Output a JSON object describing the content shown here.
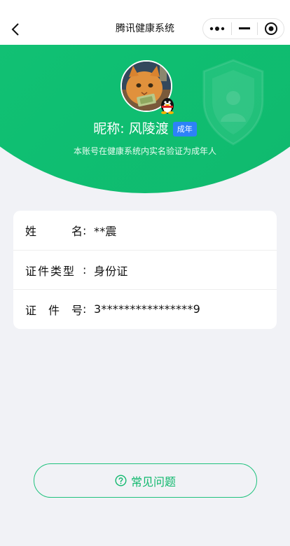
{
  "navbar": {
    "title": "腾讯健康系统",
    "back_icon": "chevron-left-icon",
    "more_icon": "more-dots-icon",
    "minimize_icon": "minimize-icon",
    "close_icon": "target-circle-icon"
  },
  "profile": {
    "nickname": "昵称: 风陵渡",
    "badge": "成年",
    "description": "本账号在健康系统内实名验证为成年人",
    "avatar_icon": "cat-avatar",
    "platform_icon": "qq-penguin-icon"
  },
  "info": [
    {
      "label_chars": [
        "姓",
        "名"
      ],
      "colon": ":",
      "value": "**震"
    },
    {
      "label_chars": [
        "证件类型"
      ],
      "colon": ":",
      "value": "身份证"
    },
    {
      "label_chars": [
        "证",
        "件",
        "号"
      ],
      "colon": ":",
      "value": "3****************9"
    }
  ],
  "faq": {
    "label": "常见问题",
    "icon": "question-circle-icon"
  },
  "colors": {
    "brand_green": "#10b86d",
    "badge_blue": "#2d82f7",
    "background": "#f1f2f6"
  }
}
